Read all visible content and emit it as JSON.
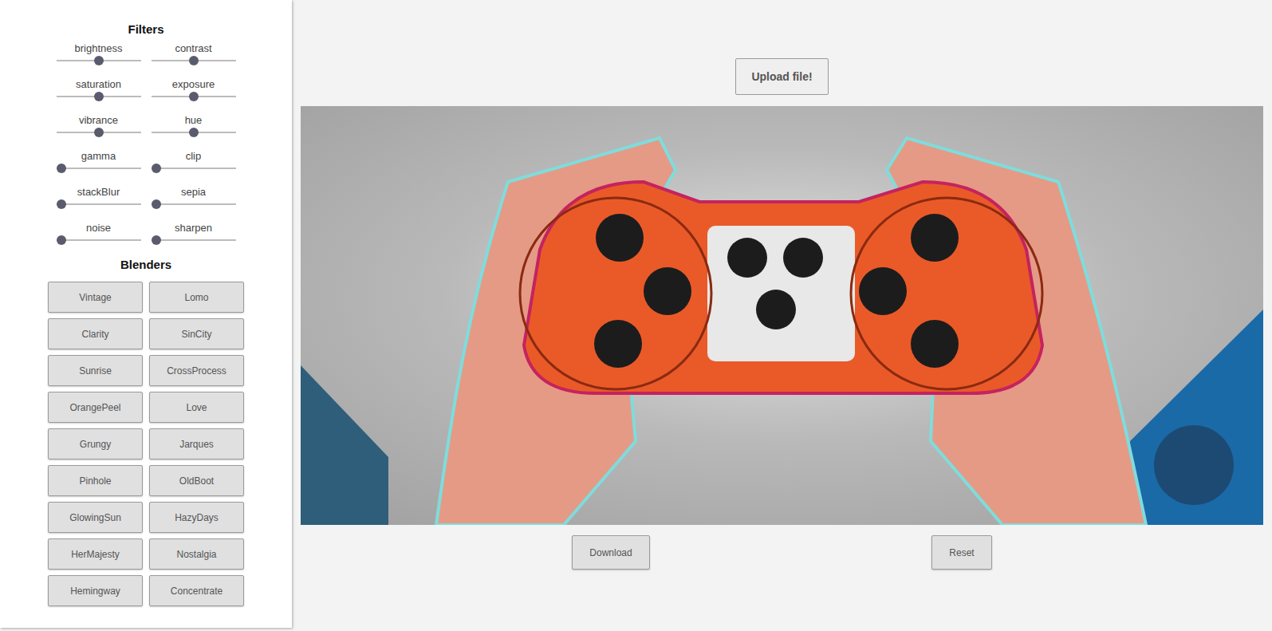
{
  "sidebar": {
    "filters_title": "Filters",
    "filters": [
      {
        "label": "brightness",
        "level": 0.5
      },
      {
        "label": "contrast",
        "level": 0.5
      },
      {
        "label": "saturation",
        "level": 0.5
      },
      {
        "label": "exposure",
        "level": 0.5
      },
      {
        "label": "vibrance",
        "level": 0.5
      },
      {
        "label": "hue",
        "level": 0.5
      },
      {
        "label": "gamma",
        "level": 0
      },
      {
        "label": "clip",
        "level": 0
      },
      {
        "label": "stackBlur",
        "level": 0
      },
      {
        "label": "sepia",
        "level": 0
      },
      {
        "label": "noise",
        "level": 0
      },
      {
        "label": "sharpen",
        "level": 0
      }
    ],
    "blenders_title": "Blenders",
    "blenders": [
      "Vintage",
      "Lomo",
      "Clarity",
      "SinCity",
      "Sunrise",
      "CrossProcess",
      "OrangePeel",
      "Love",
      "Grungy",
      "Jarques",
      "Pinhole",
      "OldBoot",
      "GlowingSun",
      "HazyDays",
      "HerMajesty",
      "Nostalgia",
      "Hemingway",
      "Concentrate"
    ]
  },
  "main": {
    "upload_button": "Upload file!",
    "download_button": "Download",
    "reset_button": "Reset"
  }
}
